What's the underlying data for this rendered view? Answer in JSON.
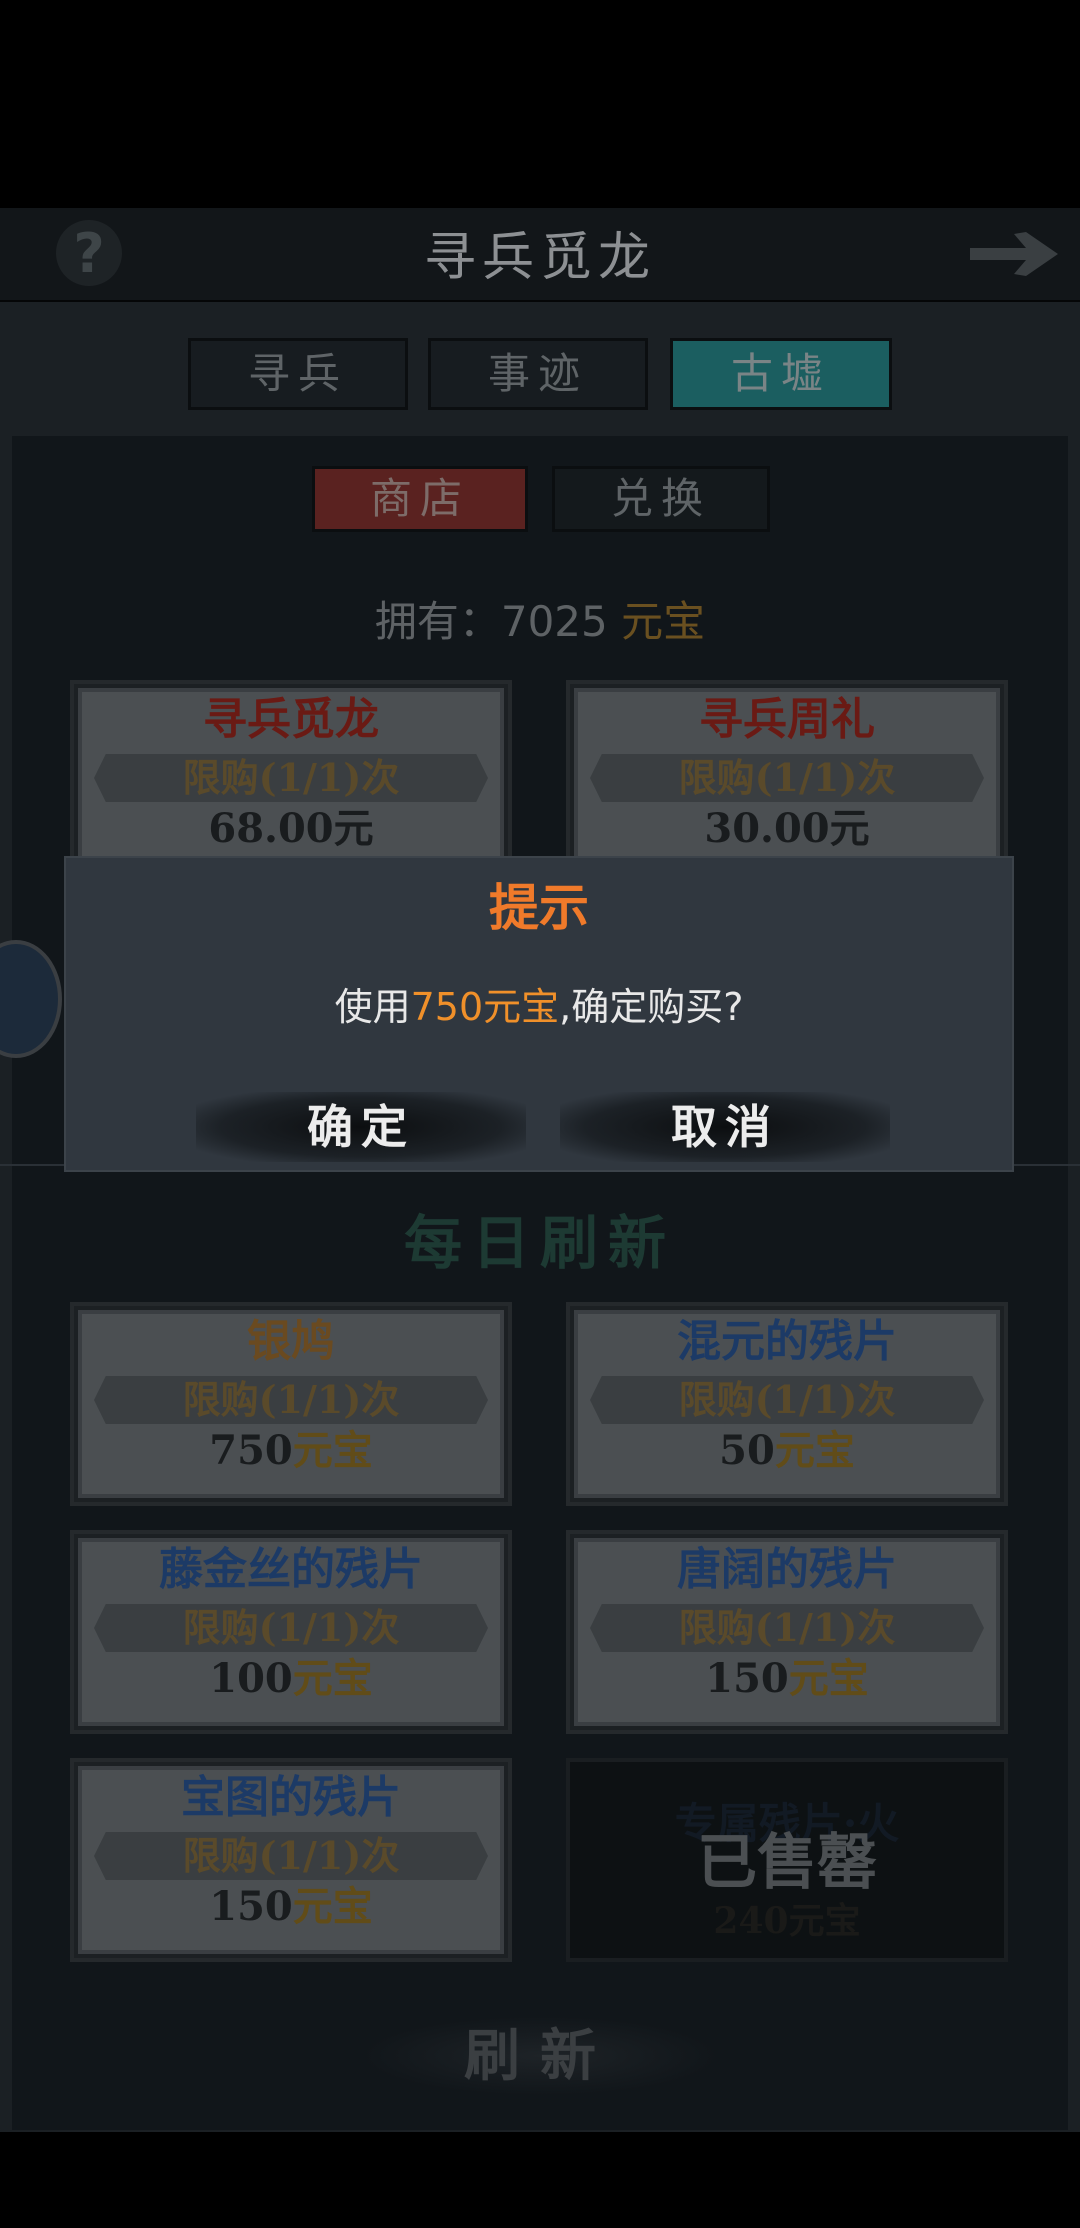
{
  "header": {
    "title": "寻兵觅龙",
    "help_icon": "question-icon",
    "back_icon": "arrow-right-icon"
  },
  "tabs": [
    {
      "label": "寻兵",
      "active": false
    },
    {
      "label": "事迹",
      "active": false
    },
    {
      "label": "古墟",
      "active": true
    }
  ],
  "subtabs": [
    {
      "label": "商店",
      "active": true
    },
    {
      "label": "兑换",
      "active": false
    }
  ],
  "balance": {
    "prefix": "拥有：7025 ",
    "currency": "元宝"
  },
  "top_cards": [
    {
      "name": "寻兵觅龙",
      "limit": "限购(1/1)次",
      "price": "68.00元",
      "name_color": "#6a1a14"
    },
    {
      "name": "寻兵周礼",
      "limit": "限购(1/1)次",
      "price": "30.00元",
      "name_color": "#6a1a14"
    }
  ],
  "daily_title": "每日刷新",
  "daily_cards": [
    {
      "name": "银鸠",
      "limit": "限购(1/1)次",
      "amount": "750",
      "currency": "元宝",
      "name_color": "#6a4a20"
    },
    {
      "name": "混元的残片",
      "limit": "限购(1/1)次",
      "amount": "50",
      "currency": "元宝",
      "name_color": "#1c3a66"
    },
    {
      "name": "藤金丝的残片",
      "limit": "限购(1/1)次",
      "amount": "100",
      "currency": "元宝",
      "name_color": "#1c3a66"
    },
    {
      "name": "唐阔的残片",
      "limit": "限购(1/1)次",
      "amount": "150",
      "currency": "元宝",
      "name_color": "#1c3a66"
    },
    {
      "name": "宝图的残片",
      "limit": "限购(1/1)次",
      "amount": "150",
      "currency": "元宝",
      "name_color": "#1c3a66"
    }
  ],
  "sold_card": {
    "name": "专属残片·火",
    "price": "240元宝",
    "sold_label": "已售罄"
  },
  "refresh_label": "刷新",
  "dialog": {
    "title": "提示",
    "msg_prefix": "使用",
    "msg_highlight": "750元宝",
    "msg_suffix": ",确定购买?",
    "confirm_label": "确定",
    "cancel_label": "取消",
    "highlight_color": "#f0902a",
    "title_color": "#f07a2a"
  }
}
